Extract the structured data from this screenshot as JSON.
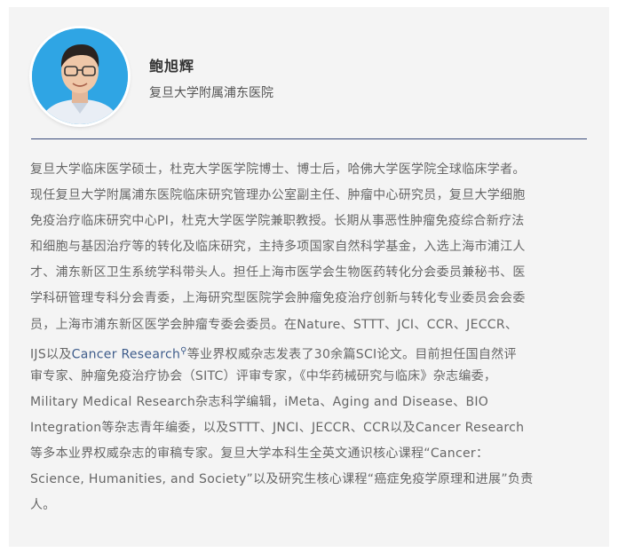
{
  "profile": {
    "name": "鲍旭辉",
    "affiliation": "复旦大学附属浦东医院"
  },
  "bio": {
    "lines": [
      "复旦大学临床医学硕士，杜克大学医学院博士、博士后，哈佛大学医学院全球临床学者。",
      "现任复旦大学附属浦东医院临床研究管理办公室副主任、肿瘤中心研究员，复旦大学细胞",
      "免疫治疗临床研究中心PI，杜克大学医学院兼职教授。长期从事恶性肿瘤免疫综合新疗法",
      "和细胞与基因治疗等的转化及临床研究，主持多项国家自然科学基金，入选上海市浦江人",
      "才、浦东新区卫生系统学科带头人。担任上海市医学会生物医药转化分会委员兼秘书、医",
      "学科研管理专科分会青委，上海研究型医院学会肿瘤免疫治疗创新与转化专业委员会会委",
      "员，上海市浦东新区医学会肿瘤专委会委员。在Nature、STTT、JCI、CCR、JECCR、"
    ],
    "line8_before": "IJS以及",
    "line8_link": "Cancer Research",
    "line8_after": "等业界权威杂志发表了30余篇SCI论文。目前担任国自然评",
    "lines_rest": [
      "审专家、肿瘤免疫治疗协会（SITC）评审专家，《中华药械研究与临床》杂志编委，",
      "Military Medical Research杂志科学编辑，iMeta、Aging and Disease、BIO",
      "Integration等杂志青年编委，以及STTT、JNCI、JECCR、CCR以及Cancer Research",
      "等多本业界权威杂志的审稿专家。复旦大学本科生全英文通识核心课程“Cancer：",
      "Science, Humanities, and Society”以及研究生核心课程“癌症免疫学原理和进展”负责",
      "人。"
    ]
  },
  "icons": {
    "link_search": "magnifier-icon",
    "avatar": "person-avatar"
  },
  "colors": {
    "card_bg": "#f4f4f4",
    "divider": "#3a4a7a",
    "link": "#3d5b8a",
    "avatar_bg": "#2fa5e4"
  }
}
